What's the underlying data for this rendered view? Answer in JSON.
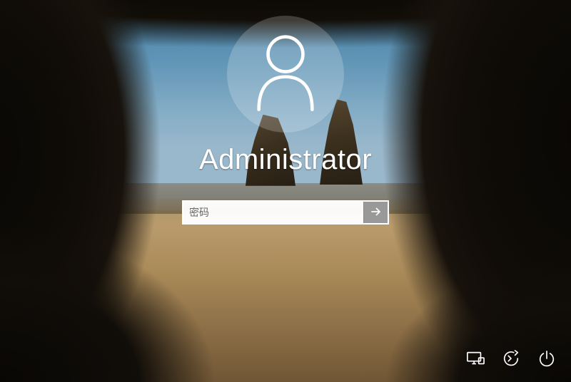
{
  "login": {
    "username": "Administrator",
    "password_placeholder": "密码",
    "password_value": ""
  },
  "icons": {
    "avatar": "user-icon",
    "submit": "arrow-right-icon",
    "network": "network-icon",
    "ease_of_access": "ease-of-access-icon",
    "power": "power-icon"
  }
}
